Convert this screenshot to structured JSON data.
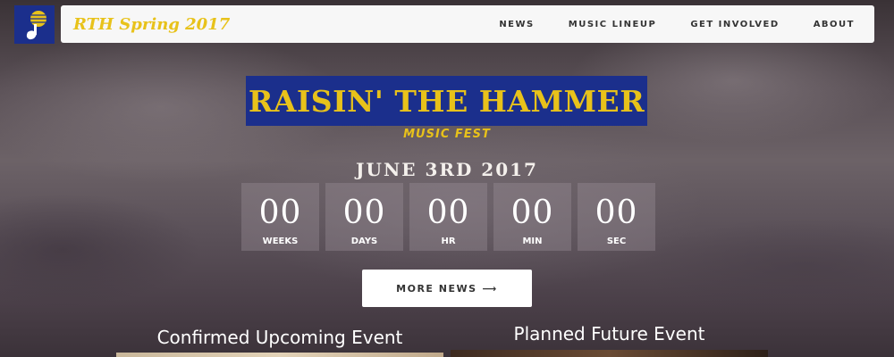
{
  "brand": {
    "title": "RTH Spring 2017"
  },
  "nav": {
    "items": [
      {
        "label": "NEWS"
      },
      {
        "label": "MUSIC LINEUP"
      },
      {
        "label": "GET INVOLVED"
      },
      {
        "label": "ABOUT"
      }
    ]
  },
  "hero": {
    "title": "RAISIN' THE HAMMER",
    "subtitle": "MUSIC FEST",
    "date": "JUNE 3RD 2017",
    "more_button": "MORE NEWS",
    "more_icon": "arrow-right-icon"
  },
  "countdown": [
    {
      "value": "00",
      "label": "WEEKS"
    },
    {
      "value": "00",
      "label": "DAYS"
    },
    {
      "value": "00",
      "label": "HR"
    },
    {
      "value": "00",
      "label": "MIN"
    },
    {
      "value": "00",
      "label": "SEC"
    }
  ],
  "sections": {
    "left_heading": "Confirmed Upcoming Event",
    "right_heading": "Planned Future Event"
  },
  "colors": {
    "brand_yellow": "#e8c21a",
    "brand_blue": "#1b2f8c"
  }
}
